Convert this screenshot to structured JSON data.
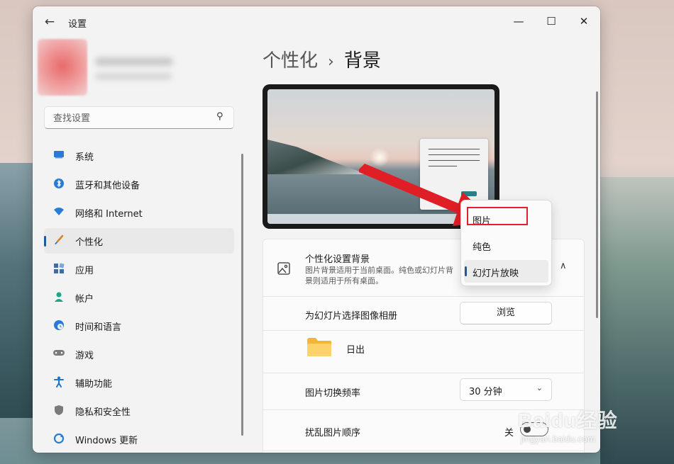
{
  "window": {
    "title": "设置",
    "back": "←",
    "min": "—",
    "max": "☐",
    "close": "✕"
  },
  "sidebar": {
    "search_placeholder": "查找设置",
    "items": [
      {
        "label": "系统",
        "icon": "monitor-icon",
        "color": "#2a7bd6"
      },
      {
        "label": "蓝牙和其他设备",
        "icon": "bluetooth-icon",
        "color": "#2a7bd6"
      },
      {
        "label": "网络和 Internet",
        "icon": "wifi-icon",
        "color": "#2a7bd6"
      },
      {
        "label": "个性化",
        "icon": "brush-icon",
        "color": "#d9822b",
        "active": true
      },
      {
        "label": "应用",
        "icon": "apps-icon",
        "color": "#3b6ea8"
      },
      {
        "label": "帐户",
        "icon": "person-icon",
        "color": "#1ea58a"
      },
      {
        "label": "时间和语言",
        "icon": "globe-clock-icon",
        "color": "#2a7bd6"
      },
      {
        "label": "游戏",
        "icon": "gamepad-icon",
        "color": "#6b6b6b"
      },
      {
        "label": "辅助功能",
        "icon": "accessibility-icon",
        "color": "#1f73c8"
      },
      {
        "label": "隐私和安全性",
        "icon": "shield-icon",
        "color": "#6b6b6b"
      },
      {
        "label": "Windows 更新",
        "icon": "update-icon",
        "color": "#2a7bd6"
      }
    ]
  },
  "main": {
    "breadcrumb_parent": "个性化",
    "breadcrumb_sep": "›",
    "breadcrumb_current": "背景",
    "card": {
      "title": "个性化设置背景",
      "desc": "图片背景适用于当前桌面。纯色或幻灯片背景则适用于所有桌面。"
    },
    "rows": {
      "album_label": "为幻灯片选择图像相册",
      "browse_label": "浏览",
      "folder_label": "日出",
      "interval_label": "图片切换频率",
      "interval_value": "30 分钟",
      "shuffle_label": "扰乱图片顺序",
      "shuffle_state": "关"
    },
    "dropdown": {
      "options": [
        "图片",
        "纯色",
        "幻灯片放映"
      ],
      "selected": "幻灯片放映"
    }
  },
  "colors": {
    "accent": "#1f5a9b",
    "highlight": "#e0222a"
  },
  "watermark": {
    "main": "Baidu经验",
    "sub": "jingyan.baidu.com"
  }
}
